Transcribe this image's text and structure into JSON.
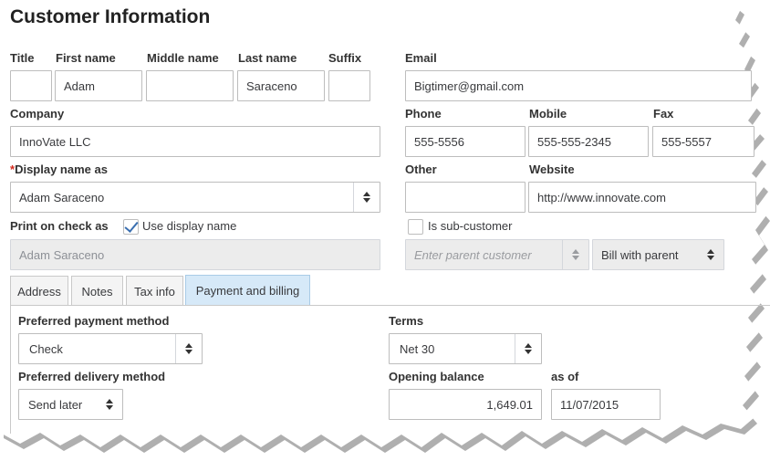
{
  "header": {
    "title": "Customer Information"
  },
  "name": {
    "title_label": "Title",
    "title_value": "",
    "first_label": "First name",
    "first_value": "Adam",
    "middle_label": "Middle name",
    "middle_value": "",
    "last_label": "Last name",
    "last_value": "Saraceno",
    "suffix_label": "Suffix",
    "suffix_value": ""
  },
  "email": {
    "label": "Email",
    "value": "Bigtimer@gmail.com"
  },
  "company": {
    "label": "Company",
    "value": "InnoVate LLC"
  },
  "phone": {
    "label": "Phone",
    "value": "555-5556"
  },
  "mobile": {
    "label": "Mobile",
    "value": "555-555-2345"
  },
  "fax": {
    "label": "Fax",
    "value": "555-5557"
  },
  "display_name": {
    "required_mark": "*",
    "label": "Display name as",
    "value": "Adam Saraceno"
  },
  "other": {
    "label": "Other",
    "value": ""
  },
  "website": {
    "label": "Website",
    "value": "http://www.innovate.com"
  },
  "print_on_check": {
    "label": "Print on check as",
    "checkbox_label": "Use display name",
    "checked": true,
    "value": "Adam Saraceno"
  },
  "sub_customer": {
    "checkbox_label": "Is sub-customer",
    "checked": false,
    "parent_placeholder": "Enter parent customer",
    "billing_value": "Bill with parent"
  },
  "tabs": [
    {
      "label": "Address",
      "active": false
    },
    {
      "label": "Notes",
      "active": false
    },
    {
      "label": "Tax info",
      "active": false
    },
    {
      "label": "Payment and billing",
      "active": true
    }
  ],
  "payment": {
    "method_label": "Preferred payment method",
    "method_value": "Check",
    "terms_label": "Terms",
    "terms_value": "Net 30",
    "delivery_label": "Preferred delivery method",
    "delivery_value": "Send later",
    "opening_label": "Opening balance",
    "opening_value": "1,649.01",
    "asof_label": "as of",
    "asof_value": "11/07/2015"
  },
  "colors": {
    "accent_tab": "#d6e9f8",
    "required": "#d52b1e",
    "check": "#3a6fb0"
  }
}
